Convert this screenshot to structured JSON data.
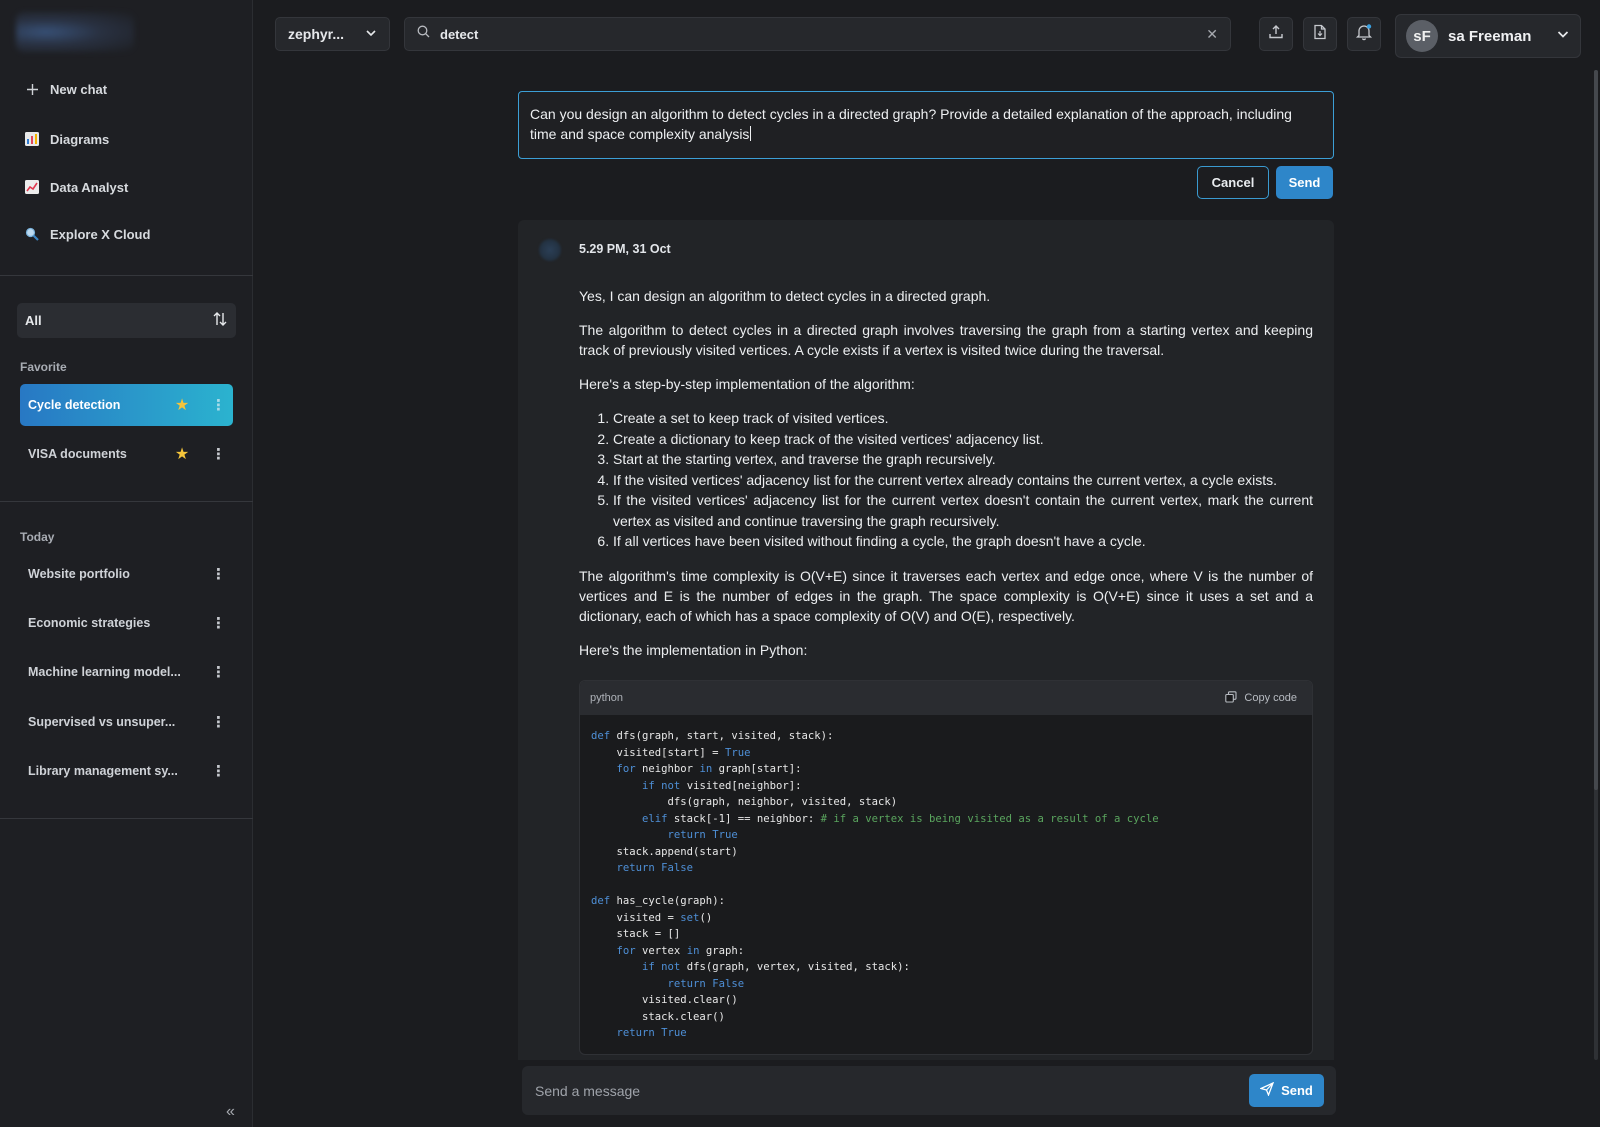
{
  "sidebar": {
    "nav": [
      {
        "label": "New chat",
        "icon": "plus-icon"
      },
      {
        "label": "Diagrams",
        "icon": "bar-chart-icon"
      },
      {
        "label": "Data Analyst",
        "icon": "line-chart-icon"
      },
      {
        "label": "Explore X Cloud",
        "icon": "magnifier-icon"
      }
    ],
    "filter": {
      "label": "All",
      "icon": "sort-icon"
    },
    "favorite_label": "Favorite",
    "favorites": [
      {
        "title": "Cycle detection",
        "starred": true,
        "active": true
      },
      {
        "title": "VISA documents",
        "starred": true,
        "active": false
      }
    ],
    "today_label": "Today",
    "today": [
      {
        "title": "Website portfolio"
      },
      {
        "title": "Economic strategies"
      },
      {
        "title": "Machine learning model..."
      },
      {
        "title": "Supervised vs unsuper..."
      },
      {
        "title": "Library management sy..."
      }
    ],
    "collapse_glyph": "«"
  },
  "topbar": {
    "model": "zephyr...",
    "search_value": "detect",
    "icons": [
      "upload-icon",
      "file-icon",
      "bell-icon"
    ],
    "user": {
      "initials": "sF",
      "name": "sa Freeman"
    }
  },
  "edit": {
    "text": "Can you design an algorithm to detect cycles in a directed graph? Provide a detailed explanation of the approach, including time and space complexity analysis",
    "cancel_label": "Cancel",
    "send_label": "Send"
  },
  "response": {
    "timestamp": "5.29 PM, 31 Oct",
    "intro": "Yes, I can design an algorithm to detect cycles in a directed graph.",
    "para1": "The algorithm to detect cycles in a directed graph involves traversing the graph from a starting vertex and keeping track of previously visited vertices. A cycle exists if a vertex is visited twice during the traversal.",
    "steps_intro": "Here's a step-by-step implementation of the algorithm:",
    "steps": [
      "Create a set to keep track of visited vertices.",
      "Create a dictionary to keep track of the visited vertices' adjacency list.",
      "Start at the starting vertex, and traverse the graph recursively.",
      "If the visited vertices' adjacency list for the current vertex already contains the current vertex, a cycle exists.",
      "If the visited vertices' adjacency list for the current vertex doesn't contain the current vertex, mark the current vertex as visited and continue traversing the graph recursively.",
      "If all vertices have been visited without finding a cycle, the graph doesn't have a cycle."
    ],
    "complexity": "The algorithm's time complexity is O(V+E) since it traverses each vertex and edge once, where V is the number of vertices and E is the number of edges in the graph. The space complexity is O(V+E) since it uses a set and a dictionary, each of which has a space complexity of O(V) and O(E), respectively.",
    "impl_intro": "Here's the implementation in Python:",
    "code_lang": "python",
    "copy_label": "Copy code"
  },
  "composer": {
    "placeholder": "Send a message",
    "send_label": "Send"
  },
  "colors": {
    "accent": "#2e86c9",
    "active_gradient_start": "#2878c4",
    "active_gradient_end": "#2bb3cf",
    "star": "#f4c43b",
    "code_keyword": "#4e8fd6",
    "code_comment": "#5aa55e"
  }
}
